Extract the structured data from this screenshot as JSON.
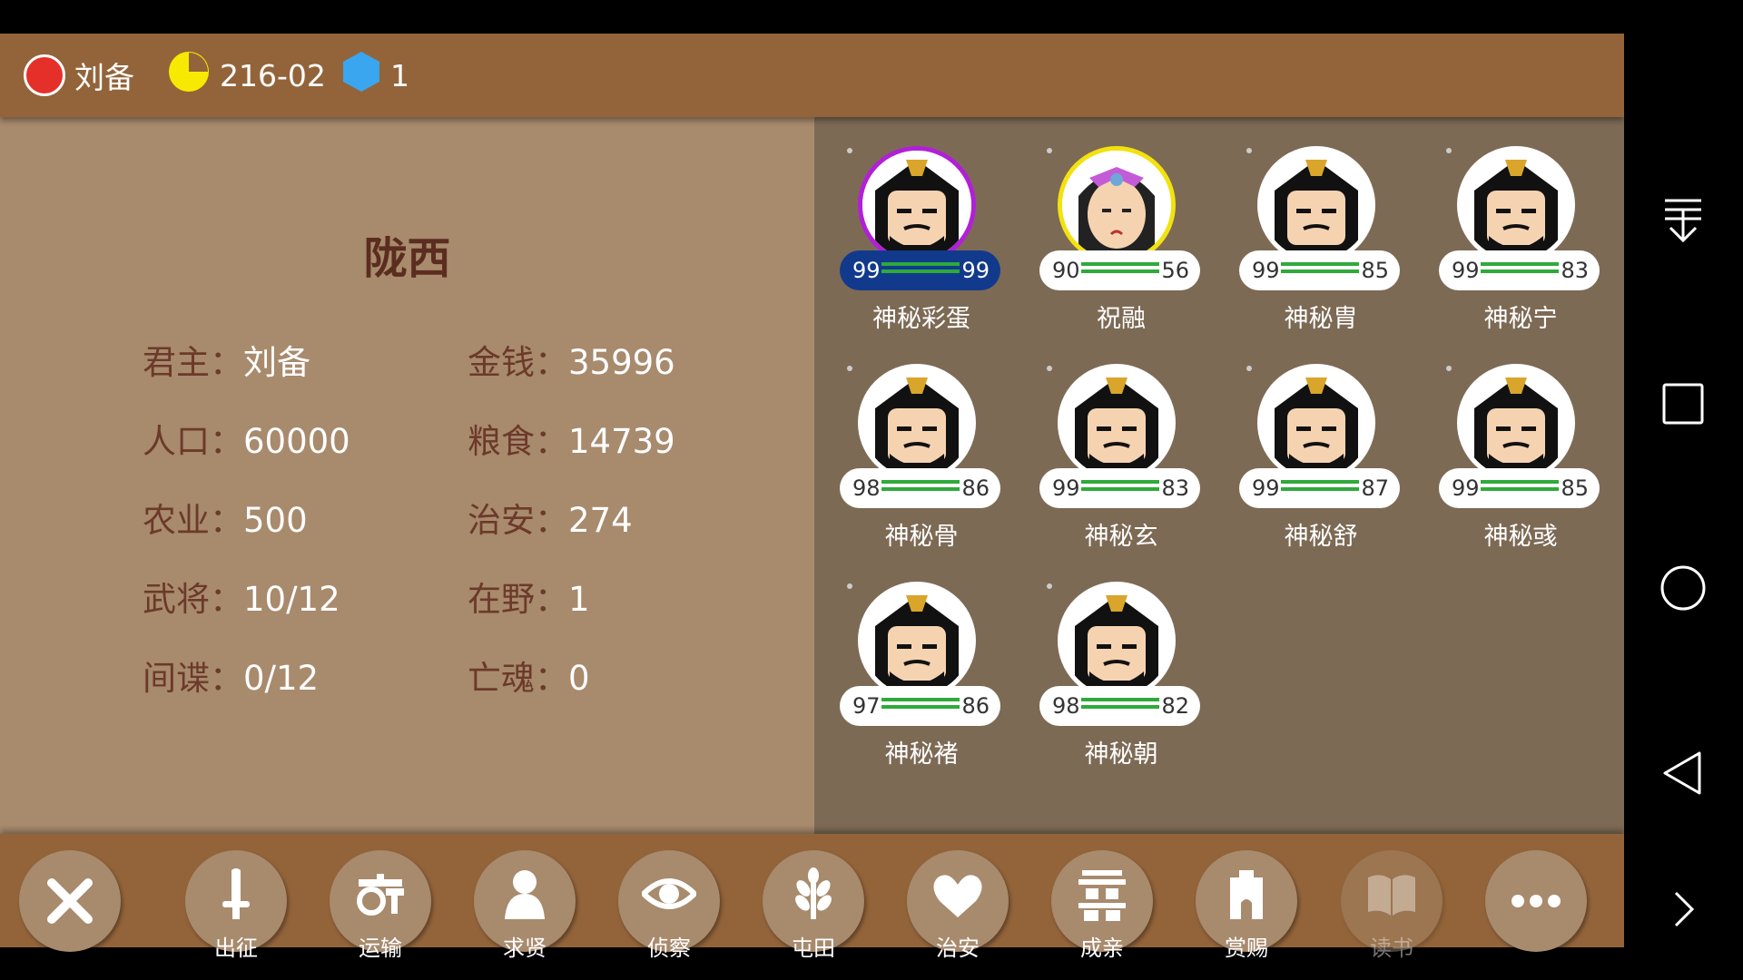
{
  "topbar": {
    "player_name": "刘备",
    "player_color": "#e5302a",
    "date": "216-02",
    "gems": "1"
  },
  "city": {
    "name": "陇西",
    "stats": [
      {
        "label": "君主：",
        "value": "刘备"
      },
      {
        "label": "金钱：",
        "value": "35996"
      },
      {
        "label": "人口：",
        "value": "60000"
      },
      {
        "label": "粮食：",
        "value": "14739"
      },
      {
        "label": "农业：",
        "value": "500"
      },
      {
        "label": "治安：",
        "value": "274"
      },
      {
        "label": "武将：",
        "value": "10/12"
      },
      {
        "label": "在野：",
        "value": "1"
      },
      {
        "label": "间谍：",
        "value": "0/12"
      },
      {
        "label": "亡魂：",
        "value": "0"
      }
    ]
  },
  "generals": [
    {
      "name": "神秘彩蛋",
      "a": "99",
      "b": "99",
      "highlight": "purple"
    },
    {
      "name": "祝融",
      "a": "90",
      "b": "56",
      "highlight": "yellow"
    },
    {
      "name": "神秘胄",
      "a": "99",
      "b": "85"
    },
    {
      "name": "神秘宁",
      "a": "99",
      "b": "83"
    },
    {
      "name": "神秘骨",
      "a": "98",
      "b": "86"
    },
    {
      "name": "神秘玄",
      "a": "99",
      "b": "83"
    },
    {
      "name": "神秘舒",
      "a": "99",
      "b": "87"
    },
    {
      "name": "神秘彧",
      "a": "99",
      "b": "85"
    },
    {
      "name": "神秘褚",
      "a": "97",
      "b": "86"
    },
    {
      "name": "神秘朝",
      "a": "98",
      "b": "82"
    }
  ],
  "actions": [
    {
      "label": "",
      "icon": "close-icon"
    },
    {
      "label": "出征",
      "icon": "sword-icon"
    },
    {
      "label": "运输",
      "icon": "cart-icon"
    },
    {
      "label": "求贤",
      "icon": "person-icon"
    },
    {
      "label": "侦察",
      "icon": "eye-icon"
    },
    {
      "label": "屯田",
      "icon": "wheat-icon"
    },
    {
      "label": "治安",
      "icon": "heart-icon"
    },
    {
      "label": "成亲",
      "icon": "double-happiness-icon"
    },
    {
      "label": "赏赐",
      "icon": "gate-icon"
    },
    {
      "label": "读书",
      "icon": "book-icon",
      "disabled": true
    },
    {
      "label": "",
      "icon": "more-icon"
    }
  ]
}
